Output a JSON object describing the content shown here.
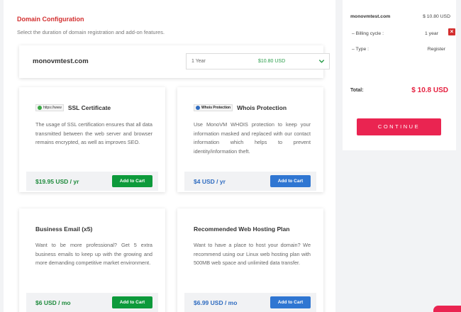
{
  "section": {
    "title": "Domain Configuration",
    "subtitle": "Select the duration of domain registration and add-on features."
  },
  "domain": {
    "name": "monovmtest.com",
    "duration": "1 Year",
    "price": "$10.80 USD"
  },
  "addons": [
    {
      "title": "SSL Certificate",
      "badge": "https://www",
      "description": "The usage of SSL certification ensures that all data transmitted between the web server and browser remains encrypted, as well as improves SEO.",
      "price": "$19.95 USD / yr",
      "button": "Add to Cart"
    },
    {
      "title": "Whois Protection",
      "badge": "Whois Protection",
      "description": "Use MonoVM WHOIS protection to keep your information masked and replaced with our contact information which helps to prevent identity/information theft.",
      "price": "$4 USD / yr",
      "button": "Add to Cart"
    },
    {
      "title": "Business Email (x5)",
      "description": "Want to be more professional? Get 5 extra business emails to keep up with the growing and more demanding competitive market environment.",
      "price": "$6 USD / mo",
      "button": "Add to Cart"
    },
    {
      "title": "Recommended Web Hosting Plan",
      "description": "Want to have a place to host your domain? We recommend using our Linux web hosting plan with 500MB web space and unlimited data transfer.",
      "price": "$6.99 USD / mo",
      "button": "Add to Cart"
    }
  ],
  "summary": {
    "domain": "monovmtest.com",
    "domain_price": "$ 10.80 USD",
    "billing_label": "– Billing cycle :",
    "billing_value": "1 year",
    "type_label": "– Type :",
    "type_value": "Register",
    "total_label": "Total:",
    "total_value": "$ 10.8 USD",
    "continue_label": "CONTINUE"
  },
  "colors": {
    "accent_red": "#d32f2f",
    "continue_pink": "#ea2451",
    "price_green": "#1e8a3c",
    "price_blue": "#2f6cc0"
  }
}
